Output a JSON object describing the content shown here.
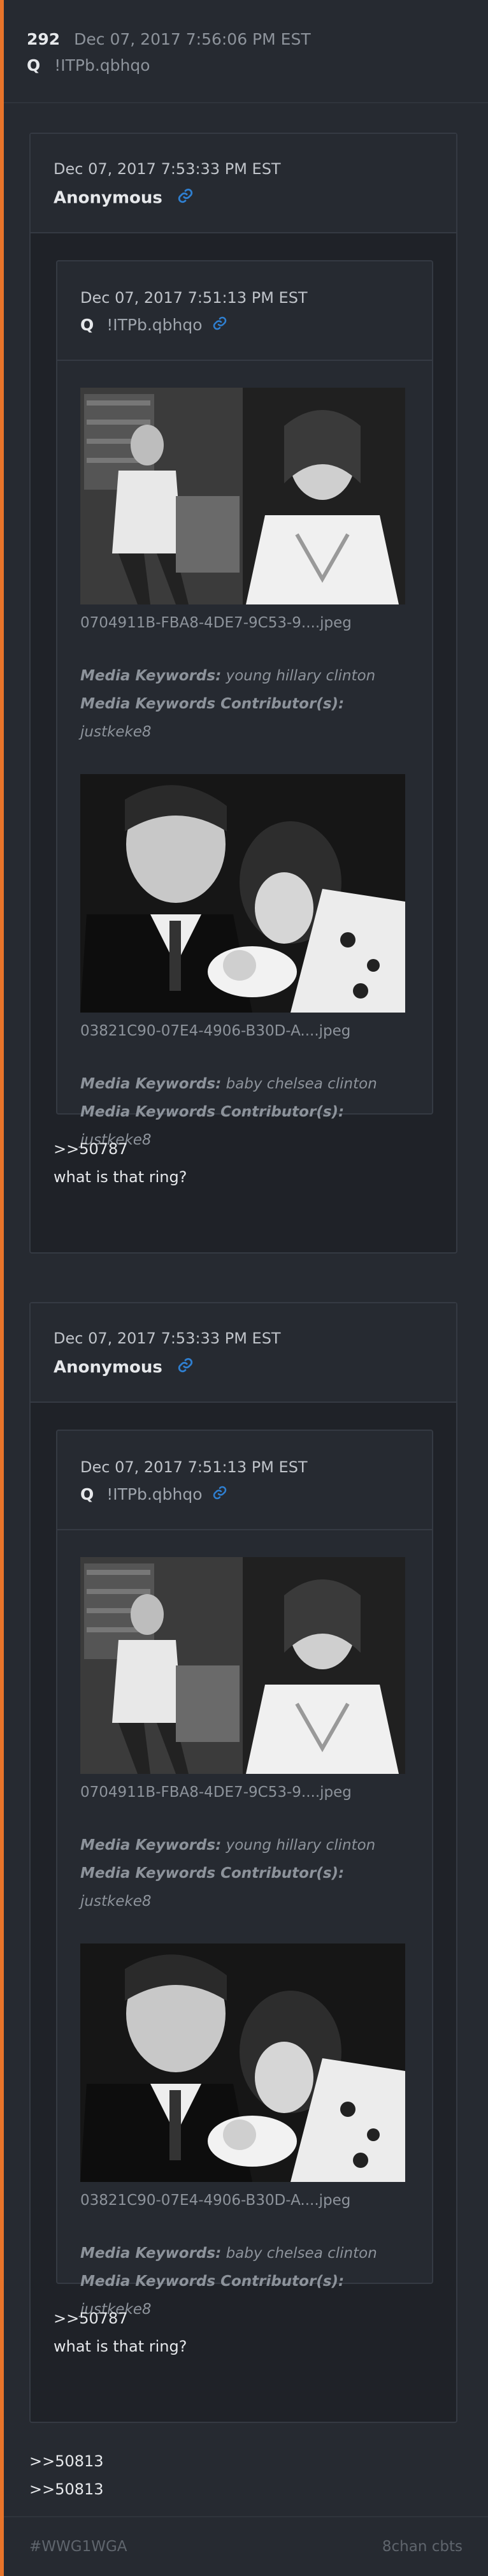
{
  "post": {
    "number": "292",
    "date": "Dec 07, 2017 7:56:06 PM EST",
    "author": "Q",
    "tripcode": "!ITPb.qbhqo"
  },
  "quotes": [
    {
      "date": "Dec 07, 2017 7:53:33 PM EST",
      "author": "Anonymous",
      "inner": {
        "date": "Dec 07, 2017 7:51:13 PM EST",
        "author": "Q",
        "tripcode": "!ITPb.qbhqo",
        "media": [
          {
            "filename": "0704911B-FBA8-4DE7-9C53-9....jpeg",
            "keywords_label": "Media Keywords:",
            "keywords": "young hillary clinton",
            "contributor_label": "Media Keywords Contributor(s):",
            "contributor": "justkeke8"
          },
          {
            "filename": "03821C90-07E4-4906-B30D-A....jpeg",
            "keywords_label": "Media Keywords:",
            "keywords": "baby chelsea clinton",
            "contributor_label": "Media Keywords Contributor(s):",
            "contributor": "justkeke8"
          }
        ]
      },
      "text_line1": ">>50787",
      "text_line2": "what is that ring?"
    },
    {
      "date": "Dec 07, 2017 7:53:33 PM EST",
      "author": "Anonymous",
      "inner": {
        "date": "Dec 07, 2017 7:51:13 PM EST",
        "author": "Q",
        "tripcode": "!ITPb.qbhqo",
        "media": [
          {
            "filename": "0704911B-FBA8-4DE7-9C53-9....jpeg",
            "keywords_label": "Media Keywords:",
            "keywords": "young hillary clinton",
            "contributor_label": "Media Keywords Contributor(s):",
            "contributor": "justkeke8"
          },
          {
            "filename": "03821C90-07E4-4906-B30D-A....jpeg",
            "keywords_label": "Media Keywords:",
            "keywords": "baby chelsea clinton",
            "contributor_label": "Media Keywords Contributor(s):",
            "contributor": "justkeke8"
          }
        ]
      },
      "text_line1": ">>50787",
      "text_line2": "what is that ring?"
    }
  ],
  "refs": [
    ">>50813",
    ">>50813"
  ],
  "footer": {
    "hashtag": "#WWG1WGA",
    "source": "8chan cbts"
  },
  "colors": {
    "accent": "#e8742a",
    "link": "#2f7fd0"
  }
}
